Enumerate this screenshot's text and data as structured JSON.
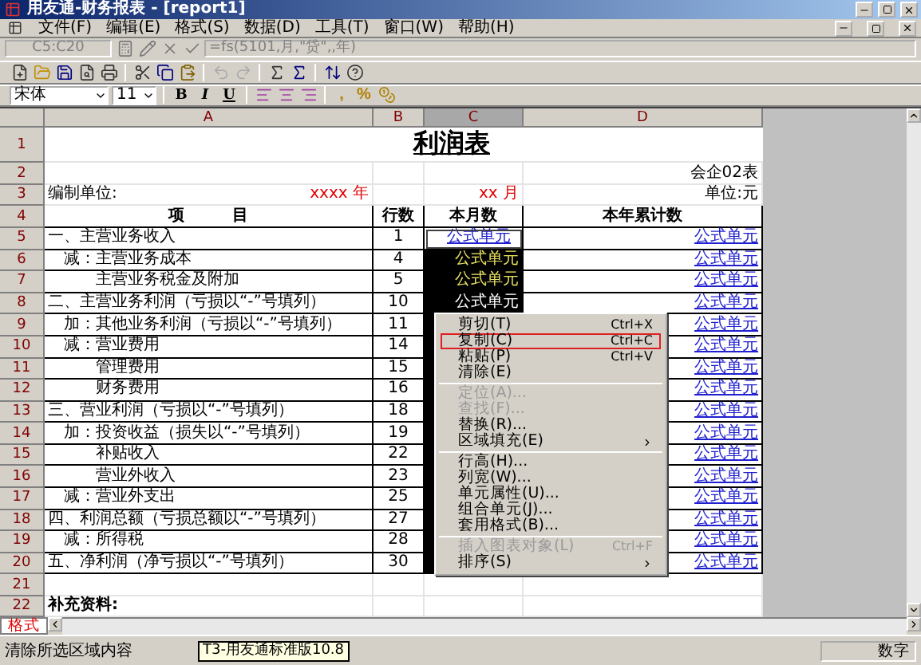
{
  "window": {
    "title": "用友通-财务报表 - [report1]"
  },
  "menu": [
    "文件(F)",
    "编辑(E)",
    "格式(S)",
    "数据(D)",
    "工具(T)",
    "窗口(W)",
    "帮助(H)"
  ],
  "formula_bar": {
    "name_box": "C5:C20",
    "formula": "=fs(5101,月,\"贷\",,年)"
  },
  "format_bar": {
    "font": "宋体",
    "size": "11",
    "style_buttons": [
      "B",
      "I",
      "U"
    ],
    "number_buttons": [
      ",",
      "%"
    ]
  },
  "columns": [
    {
      "label": "A",
      "selected": false
    },
    {
      "label": "B",
      "selected": false
    },
    {
      "label": "C",
      "selected": true
    },
    {
      "label": "D",
      "selected": false
    }
  ],
  "rows": [
    {
      "n": "1",
      "kind": "title",
      "title": "利润表"
    },
    {
      "n": "2",
      "kind": "plain",
      "d": "会企02表"
    },
    {
      "n": "3",
      "kind": "date",
      "a": "编制单位:",
      "year": "xxxx 年",
      "c": "xx 月",
      "d": "单位:元"
    },
    {
      "n": "4",
      "kind": "header",
      "a": "项　　　目",
      "b": "行数",
      "c": "本月数",
      "d": "本年累计数"
    },
    {
      "n": "5",
      "kind": "body",
      "a": "一、主营业务收入",
      "b": "1",
      "c": {
        "text": "公式单元",
        "selected": true,
        "active": true,
        "kind": "link"
      },
      "d": "公式单元"
    },
    {
      "n": "6",
      "kind": "body",
      "a": "　减：主营业务成本",
      "b": "4",
      "c": {
        "text": "公式单元",
        "selected": true,
        "active": false,
        "kind": "yellow"
      },
      "d": "公式单元"
    },
    {
      "n": "7",
      "kind": "body",
      "a": "　　　主营业务税金及附加",
      "b": "5",
      "c": {
        "text": "公式单元",
        "selected": true,
        "active": false,
        "kind": "yellow"
      },
      "d": "公式单元"
    },
    {
      "n": "8",
      "kind": "body",
      "a": "二、主营业务利润（亏损以“-”号填列）",
      "b": "10",
      "c": {
        "text": "公式单元",
        "selected": true,
        "active": false,
        "kind": "white"
      },
      "d": "公式单元"
    },
    {
      "n": "9",
      "kind": "body",
      "a": "　加：其他业务利润（亏损以“-”号填列）",
      "b": "11",
      "c": {
        "selected": true,
        "active": false
      },
      "d": "公式单元"
    },
    {
      "n": "10",
      "kind": "body",
      "a": "　减：营业费用",
      "b": "14",
      "c": {
        "selected": true,
        "active": false
      },
      "d": "公式单元"
    },
    {
      "n": "11",
      "kind": "body",
      "a": "　　　管理费用",
      "b": "15",
      "c": {
        "selected": true,
        "active": false
      },
      "d": "公式单元"
    },
    {
      "n": "12",
      "kind": "body",
      "a": "　　　财务费用",
      "b": "16",
      "c": {
        "selected": true,
        "active": false
      },
      "d": "公式单元"
    },
    {
      "n": "13",
      "kind": "body",
      "a": "三、营业利润（亏损以“-”号填列）",
      "b": "18",
      "c": {
        "selected": true,
        "active": false
      },
      "d": "公式单元"
    },
    {
      "n": "14",
      "kind": "body",
      "a": "　加：投资收益（损失以“-”号填列）",
      "b": "19",
      "c": {
        "selected": true,
        "active": false
      },
      "d": "公式单元"
    },
    {
      "n": "15",
      "kind": "body",
      "a": "　　　补贴收入",
      "b": "22",
      "c": {
        "selected": true,
        "active": false
      },
      "d": "公式单元"
    },
    {
      "n": "16",
      "kind": "body",
      "a": "　　　营业外收入",
      "b": "23",
      "c": {
        "selected": true,
        "active": false
      },
      "d": "公式单元"
    },
    {
      "n": "17",
      "kind": "body",
      "a": "　减：营业外支出",
      "b": "25",
      "c": {
        "selected": true,
        "active": false
      },
      "d": "公式单元"
    },
    {
      "n": "18",
      "kind": "body",
      "a": "四、利润总额（亏损总额以“-”号填列）",
      "b": "27",
      "c": {
        "selected": true,
        "active": false
      },
      "d": "公式单元"
    },
    {
      "n": "19",
      "kind": "body",
      "a": "　减：所得税",
      "b": "28",
      "c": {
        "selected": true,
        "active": false
      },
      "d": "公式单元"
    },
    {
      "n": "20",
      "kind": "body",
      "a": "五、净利润（净亏损以“-”号填列）",
      "b": "30",
      "c": {
        "selected": true,
        "active": false
      },
      "d": "公式单元"
    },
    {
      "n": "21",
      "kind": "plain"
    },
    {
      "n": "22",
      "kind": "note",
      "a": "补充资料:"
    }
  ],
  "context_menu": [
    {
      "kind": "item",
      "label": "剪切(T)",
      "shortcut": "Ctrl+X",
      "disabled": false,
      "highlighted": false
    },
    {
      "kind": "item",
      "label": "复制(C)",
      "shortcut": "Ctrl+C",
      "disabled": false,
      "highlighted": true
    },
    {
      "kind": "item",
      "label": "粘贴(P)",
      "shortcut": "Ctrl+V",
      "disabled": false,
      "highlighted": false
    },
    {
      "kind": "item",
      "label": "清除(E)",
      "disabled": false,
      "highlighted": false
    },
    {
      "kind": "separator"
    },
    {
      "kind": "item",
      "label": "定位(A)...",
      "disabled": true,
      "highlighted": false
    },
    {
      "kind": "item",
      "label": "查找(F)...",
      "disabled": true,
      "highlighted": false
    },
    {
      "kind": "item",
      "label": "替换(R)...",
      "disabled": false,
      "highlighted": false
    },
    {
      "kind": "submenu",
      "label": "区域填充(E)",
      "disabled": false,
      "highlighted": false
    },
    {
      "kind": "separator"
    },
    {
      "kind": "item",
      "label": "行高(H)...",
      "disabled": false,
      "highlighted": false
    },
    {
      "kind": "item",
      "label": "列宽(W)...",
      "disabled": false,
      "highlighted": false
    },
    {
      "kind": "item",
      "label": "单元属性(U)...",
      "disabled": false,
      "highlighted": false
    },
    {
      "kind": "item",
      "label": "组合单元(J)...",
      "disabled": false,
      "highlighted": false
    },
    {
      "kind": "item",
      "label": "套用格式(B)...",
      "disabled": false,
      "highlighted": false
    },
    {
      "kind": "separator"
    },
    {
      "kind": "item",
      "label": "插入图表对象(L)",
      "shortcut": "Ctrl+F",
      "disabled": true,
      "highlighted": false
    },
    {
      "kind": "submenu",
      "label": "排序(S)",
      "disabled": false,
      "highlighted": false
    }
  ],
  "sheet_tabs": [
    {
      "label": "格式",
      "selected": true
    }
  ],
  "status_bar": {
    "message": "清除所选区域内容",
    "tooltip": "T3-用友通标准版10.8",
    "mode": "数字"
  }
}
